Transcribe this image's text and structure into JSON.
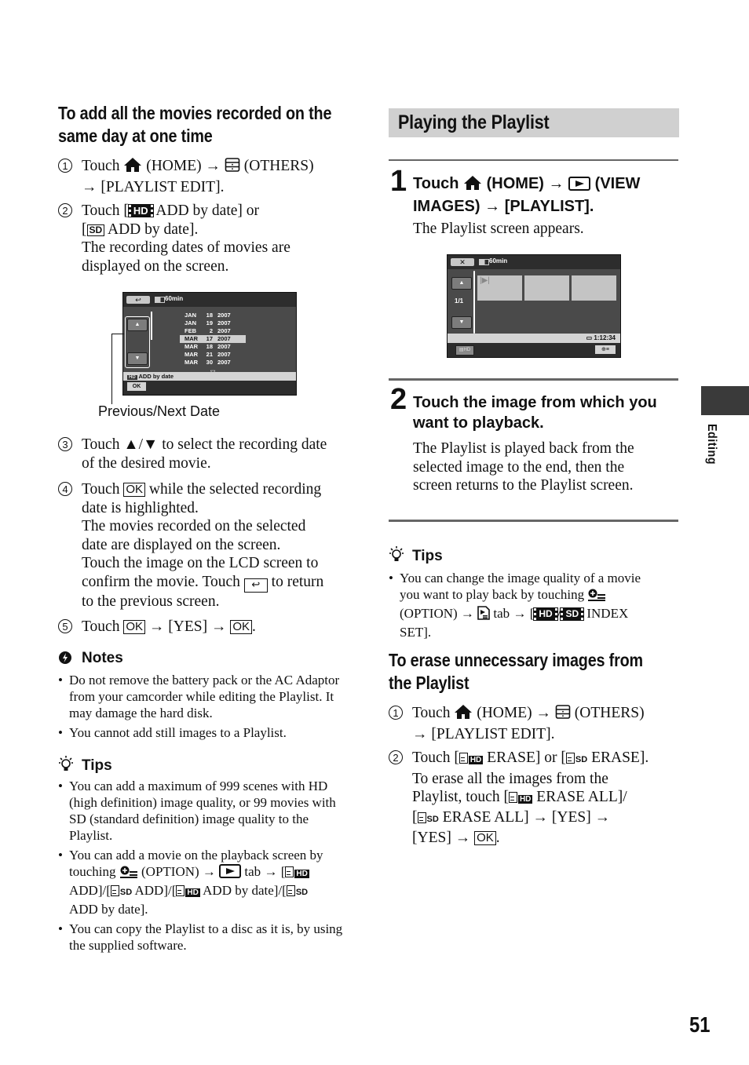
{
  "left_section": {
    "heading": "To add all the movies recorded on the same day at one time",
    "heading_line1": "To add all the movies recorded on the",
    "heading_line2": "same day at one time",
    "steps": [
      {
        "num": "1",
        "parts": {
          "touch": "Touch",
          "home": "(HOME)",
          "others": "(OTHERS)",
          "edit": "[PLAYLIST EDIT]."
        }
      },
      {
        "num": "2",
        "parts": {
          "touch": "Touch [",
          "hd": "HD",
          "add1": "ADD by date] or",
          "open": "[",
          "sd": "SD",
          "add2": "ADD by date].",
          "desc1": "The recording dates of movies are",
          "desc2": "displayed on the screen."
        }
      },
      {
        "num": "3",
        "parts": {
          "l1": "Touch ▲/▼ to select the recording date",
          "l2": "of the desired movie."
        }
      },
      {
        "num": "4",
        "parts": {
          "touch": "Touch",
          "ok": "OK",
          "l1rest": "while the selected recording",
          "l2": "date is highlighted.",
          "l3": "The movies recorded on the selected",
          "l4": "date are displayed on the screen.",
          "l5": "Touch the image on the LCD screen to",
          "l6a": "confirm the movie. Touch",
          "l6b": "to return",
          "l7": "to the previous screen."
        }
      },
      {
        "num": "5",
        "parts": {
          "touch": "Touch",
          "ok1": "OK",
          "yes": "[YES]",
          "ok2": "OK",
          "end": "."
        }
      }
    ],
    "arrow": "→",
    "lcd_screen": {
      "battery": "60min",
      "dates": [
        {
          "month": "JAN",
          "day": "18",
          "year": "2007",
          "selected": false
        },
        {
          "month": "JAN",
          "day": "19",
          "year": "2007",
          "selected": false
        },
        {
          "month": "FEB",
          "day": "2",
          "year": "2007",
          "selected": false
        },
        {
          "month": "MAR",
          "day": "17",
          "year": "2007",
          "selected": true
        },
        {
          "month": "MAR",
          "day": "18",
          "year": "2007",
          "selected": false
        },
        {
          "month": "MAR",
          "day": "21",
          "year": "2007",
          "selected": false
        },
        {
          "month": "MAR",
          "day": "30",
          "year": "2007",
          "selected": false
        }
      ],
      "footer_badge": "HD",
      "footer_label": "ADD by date",
      "ok_label": "OK",
      "callout": "Previous/Next Date"
    },
    "notes": {
      "title": "Notes",
      "items": [
        "Do not remove the battery pack or the AC Adaptor from your camcorder while editing the Playlist. It may damage the hard disk.",
        "You cannot add still images to a Playlist."
      ]
    },
    "tips": {
      "title": "Tips",
      "item1": "You can add a maximum of 999 scenes with HD (high definition) image quality, or 99 movies with SD (standard definition) image quality to the Playlist.",
      "item2": {
        "a": "You can add a movie on the playback screen by touching",
        "b": "(OPTION)",
        "c": "tab",
        "d": "[",
        "e": "ADD]/[",
        "f": "ADD]/[",
        "g": "ADD by date]/[",
        "h": "ADD by date]."
      },
      "item3": "You can copy the Playlist to a disc as it is, by using the supplied software."
    }
  },
  "right_section": {
    "title": "Playing the Playlist",
    "step1": {
      "num": "1",
      "touch": "Touch",
      "home": "(HOME)",
      "view": "(VIEW",
      "images": "IMAGES)",
      "playlist": "[PLAYLIST].",
      "desc": "The Playlist screen appears."
    },
    "lcd_screen": {
      "battery": "60min",
      "page": "1/1",
      "duration": "1:12:34"
    },
    "step2": {
      "num": "2",
      "head1": "Touch the image from which you",
      "head2": "want to playback.",
      "desc1": "The Playlist is played back from the",
      "desc2": "selected image to the end, then the",
      "desc3": "screen returns to the Playlist screen."
    },
    "tips": {
      "title": "Tips",
      "a": "You can change the image quality of a movie",
      "b": "you want to play back by touching",
      "c": "(OPTION)",
      "d": "tab",
      "e": "[",
      "f": "/",
      "g": "INDEX",
      "h": "SET]."
    },
    "erase": {
      "heading1": "To erase unnecessary images from",
      "heading2": "the Playlist",
      "step1": {
        "num": "1",
        "touch": "Touch",
        "home": "(HOME)",
        "others": "(OTHERS)",
        "edit": "[PLAYLIST EDIT]."
      },
      "step2": {
        "num": "2",
        "a": "Touch [",
        "b": "ERASE] or [",
        "c": "ERASE].",
        "d": "To erase all the images from the",
        "e": "Playlist, touch [",
        "f": "ERASE ALL]/",
        "g": "[",
        "h": "ERASE ALL]",
        "yes1": "[YES]",
        "yes2": "[YES]",
        "ok": "OK",
        "end": "."
      }
    }
  },
  "side_tab": {
    "label": "Editing"
  },
  "page_number": "51"
}
